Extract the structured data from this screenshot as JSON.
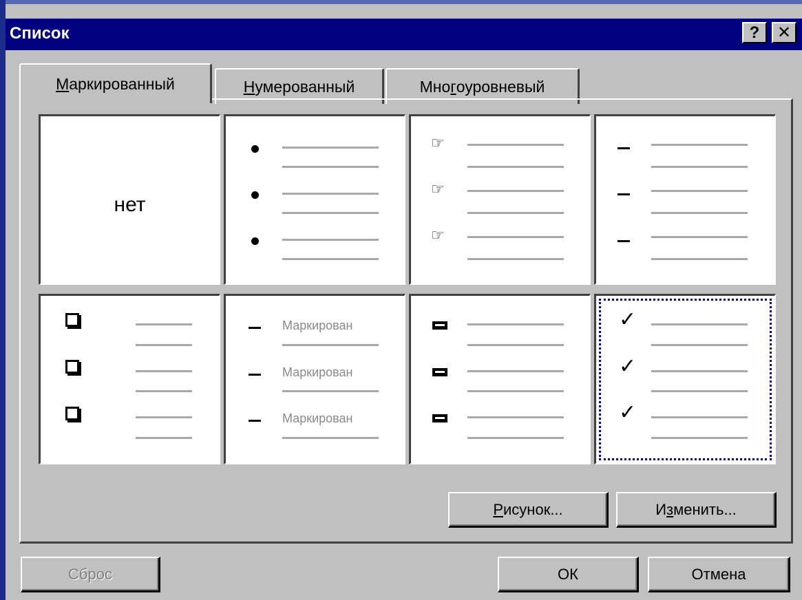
{
  "window": {
    "title": "Список",
    "help_label": "?",
    "close_label": "✕"
  },
  "tabs": [
    {
      "label_ul": "М",
      "label_rest": "аркированный",
      "active": true
    },
    {
      "label_ul": "Н",
      "label_rest": "умерованный",
      "active": false
    },
    {
      "label_pre": "Мно",
      "label_ul": "г",
      "label_rest": "оуровневый",
      "active": false
    }
  ],
  "bullet_styles": [
    {
      "name": "none",
      "text": "нет"
    },
    {
      "name": "dot",
      "icon": "filled-circle-icon"
    },
    {
      "name": "pointing-hand",
      "icon": "pointing-hand-icon",
      "glyph": "☞"
    },
    {
      "name": "dash",
      "icon": "dash-icon"
    },
    {
      "name": "square",
      "icon": "square-bullet-icon"
    },
    {
      "name": "dash-text",
      "icon": "dash-icon",
      "sample_text": "Маркирован"
    },
    {
      "name": "key",
      "icon": "key-bullet-icon"
    },
    {
      "name": "check",
      "icon": "check-mark-icon",
      "glyph": "✓",
      "selected": true
    }
  ],
  "buttons": {
    "picture": {
      "ul": "Р",
      "rest": "исунок..."
    },
    "modify": {
      "pre": "И",
      "ul": "з",
      "rest": "менить..."
    },
    "reset": "Сброс",
    "ok": "ОК",
    "cancel": "Отмена"
  },
  "colors": {
    "titlebar": "#000080",
    "face": "#c0c0c0",
    "selection": "#000080"
  }
}
